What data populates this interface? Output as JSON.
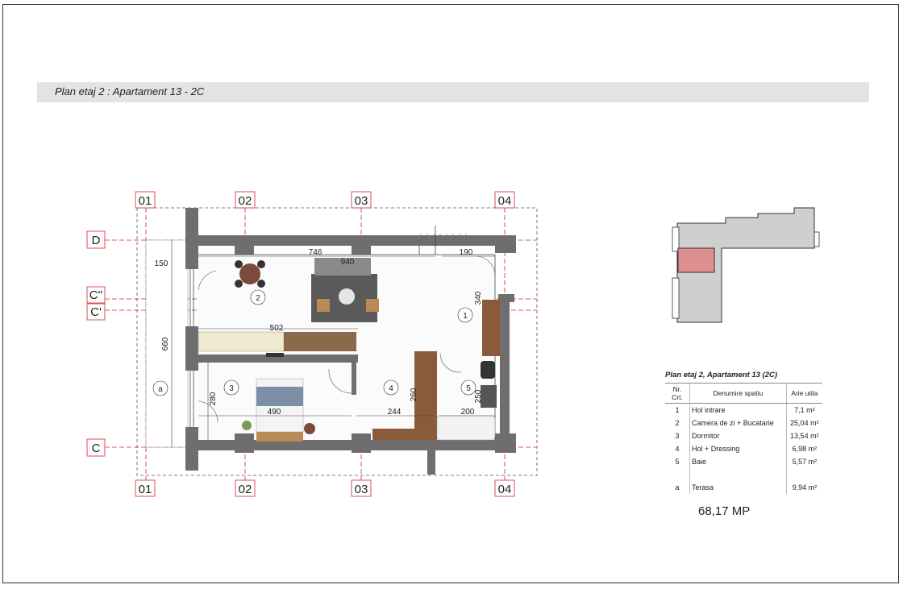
{
  "title": "Plan etaj 2 : Apartament  13 - 2C",
  "grid_columns_top": [
    "01",
    "02",
    "03",
    "04"
  ],
  "grid_columns_bottom": [
    "01",
    "02",
    "03",
    "04"
  ],
  "grid_rows": [
    "D",
    "C''",
    "C'",
    "C"
  ],
  "dimensions": {
    "d746": "746",
    "d940": "940",
    "d190": "190",
    "d150": "150",
    "d340": "340",
    "d660": "660",
    "d502": "502",
    "d280": "280",
    "d490": "490",
    "d244": "244",
    "d200": "200",
    "d260": "260",
    "d250": "250"
  },
  "room_labels": {
    "r1": "1",
    "r2": "2",
    "r3": "3",
    "r4": "4",
    "r5": "5",
    "ra": "a"
  },
  "legend": {
    "title": "Plan etaj 2, Apartament 13 (2C)",
    "headers": [
      "Nr. Crt.",
      "Denumire spatiu",
      "Arie utila"
    ],
    "rows": [
      {
        "nr": "1",
        "name": "Hol intrare",
        "area": "7,1 m²"
      },
      {
        "nr": "2",
        "name": "Camera de zi + Bucatarie",
        "area": "25,04 m²"
      },
      {
        "nr": "3",
        "name": "Dormitor",
        "area": "13,54 m²"
      },
      {
        "nr": "4",
        "name": "Hol + Dressing",
        "area": "6,98 m²"
      },
      {
        "nr": "5",
        "name": "Baie",
        "area": "5,57 m²"
      },
      {
        "nr": "",
        "name": "",
        "area": ""
      },
      {
        "nr": "a",
        "name": "Terasa",
        "area": "9,94 m²"
      }
    ]
  },
  "total": "68,17 MP",
  "colors": {
    "wall": "#6e6e6e",
    "axis": "#d0272b",
    "highlight": "#e08f8f",
    "keyplan_fill": "#cfcfcf",
    "floor": "#d8c8a8"
  }
}
